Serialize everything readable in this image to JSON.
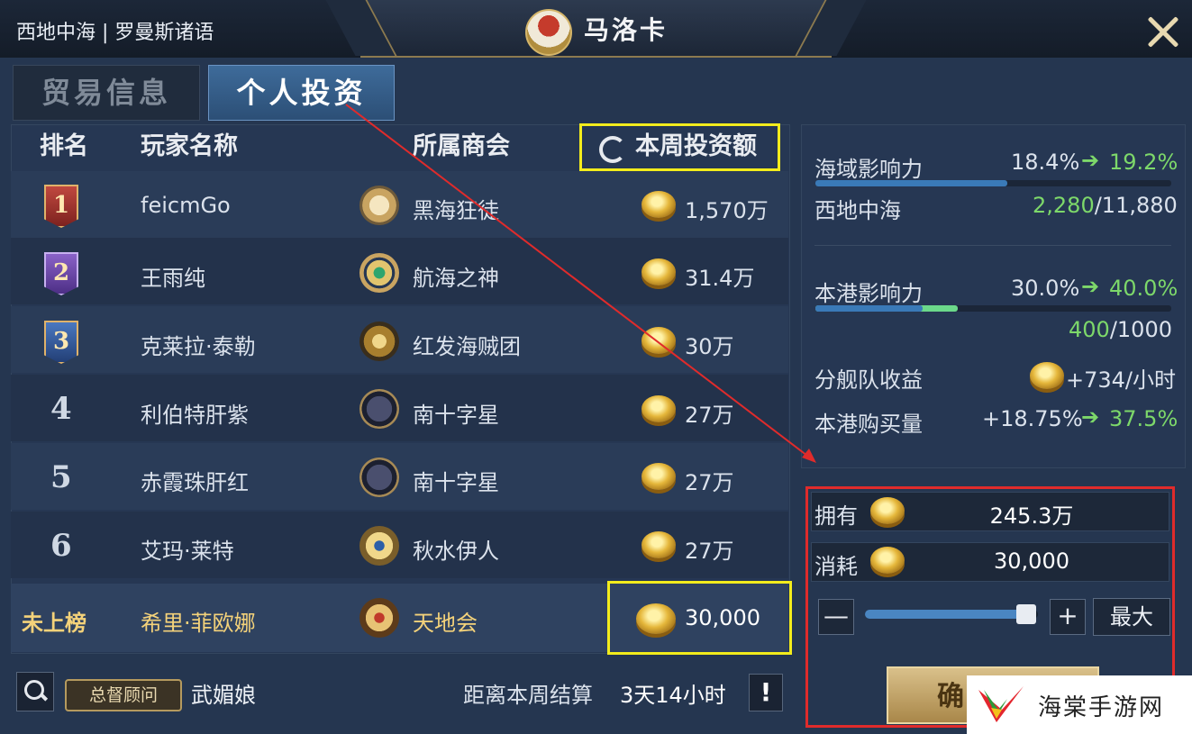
{
  "header": {
    "location": "西地中海 | 罗曼斯诸语",
    "port_name": "马洛卡",
    "close_icon": "close-x-icon"
  },
  "tabs": [
    {
      "label": "贸易信息",
      "active": false
    },
    {
      "label": "个人投资",
      "active": true
    }
  ],
  "table": {
    "columns": [
      "排名",
      "玩家名称",
      "所属商会",
      "本周投资额"
    ],
    "sort_icon": "refresh-icon",
    "rows": [
      {
        "rank": "1",
        "player": "feicmGo",
        "guild": "黑海狂徒",
        "amount": "1,570万"
      },
      {
        "rank": "2",
        "player": "王雨纯",
        "guild": "航海之神",
        "amount": "31.4万"
      },
      {
        "rank": "3",
        "player": "克莱拉·泰勒",
        "guild": "红发海贼团",
        "amount": "30万"
      },
      {
        "rank": "4",
        "player": "利伯特肝紫",
        "guild": "南十字星",
        "amount": "27万"
      },
      {
        "rank": "5",
        "player": "赤霞珠肝红",
        "guild": "南十字星",
        "amount": "27万"
      },
      {
        "rank": "6",
        "player": "艾玛·莱特",
        "guild": "秋水伊人",
        "amount": "27万"
      }
    ],
    "mine": {
      "rank": "未上榜",
      "player": "希里·菲欧娜",
      "guild": "天地会",
      "amount": "30,000"
    }
  },
  "footer": {
    "title_badge": "总督顾问",
    "advisor_name": "武媚娘",
    "settle_label": "距离本周结算",
    "settle_time": "3天14小时",
    "info_label": "!"
  },
  "stats": {
    "sea_influence": {
      "label": "海域影响力",
      "from": "18.4%",
      "to": "19.2%",
      "fill": 0.54
    },
    "sea_region": {
      "label": "西地中海",
      "current": "2,280",
      "total": "/11,880"
    },
    "port_influence": {
      "label": "本港影响力",
      "from": "30.0%",
      "to": "40.0%",
      "fill_blue": 0.3,
      "fill_green": 0.4
    },
    "port_points": {
      "current": "400",
      "total": "/1000"
    },
    "fleet_income": {
      "label": "分舰队收益",
      "value": "+734/小时"
    },
    "port_purchase": {
      "label": "本港购买量",
      "from": "+18.75%",
      "to": "37.5%"
    }
  },
  "invest": {
    "own_label": "拥有",
    "own_value": "245.3万",
    "cost_label": "消耗",
    "cost_value": "30,000",
    "slider_value": 0.97,
    "minus_icon": "minus-icon",
    "plus_icon": "plus-icon",
    "max_label": "最大",
    "confirm_label": "确"
  },
  "watermark": {
    "text": "海棠手游网"
  },
  "colors": {
    "highlight": "#f3ec1c",
    "annotation": "#e02b2b",
    "increase": "#7dd86a",
    "gold": "#f4d27a"
  }
}
